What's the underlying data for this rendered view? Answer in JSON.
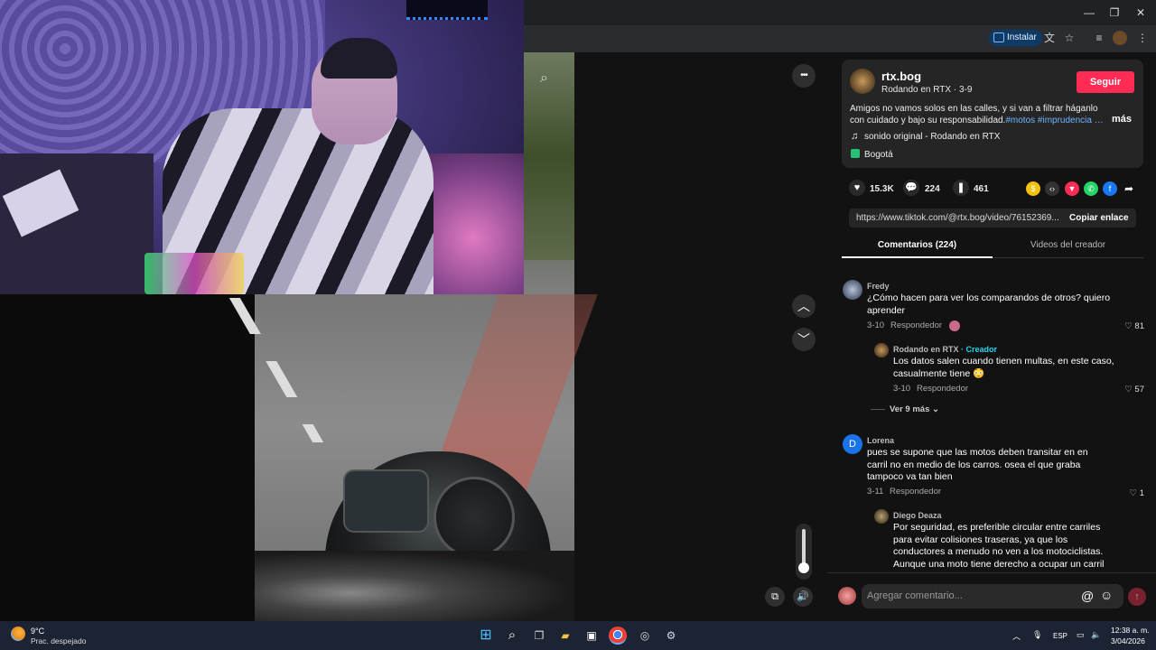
{
  "browser": {
    "install_label": "Instalar",
    "window_controls": [
      "—",
      "❐",
      "✕"
    ]
  },
  "video_controls": {
    "more_label": "•••",
    "volume_level": 0.75
  },
  "post": {
    "username": "rtx.bog",
    "nickname": "Rodando en RTX · 3-9",
    "follow_label": "Seguir",
    "description": "Amigos no vamos solos en las calles, y si van a filtrar háganlo con cuidado y bajo su responsabilidad.",
    "hashtags": "#motos #imprudencia …",
    "more_label": "más",
    "music": "sonido original - Rodando en RTX",
    "location": "Bogotá",
    "likes": "15.3K",
    "comments_count": "224",
    "saves": "461",
    "link": "https://www.tiktok.com/@rtx.bog/video/76152369...",
    "copy_label": "Copiar enlace"
  },
  "tabs": {
    "comments": "Comentarios (224)",
    "creator_videos": "Videos del creador"
  },
  "comments": [
    {
      "name": "Fredy",
      "text": "¿Cómo hacen para ver los comparandos de otros? quiero aprender",
      "date": "3-10",
      "reply_label": "Respondedor",
      "likes": "81",
      "reply": {
        "name": "Rodando en RTX",
        "creator_tag": "· Creador",
        "text": "Los datos salen cuando tienen multas, en este caso, casualmente tiene 😳",
        "date": "3-10",
        "reply_label": "Respondedor",
        "likes": "57"
      },
      "view_more": "Ver 9 más"
    },
    {
      "name": "Lorena",
      "avatar_letter": "D",
      "text": "pues se supone que las motos deben transitar en en carril no en medio de los carros. osea el que graba tampoco va tan bien",
      "date": "3-11",
      "reply_label": "Respondedor",
      "likes": "1",
      "reply": {
        "name": "Diego Deaza",
        "text": "Por seguridad, es preferible circular entre carriles para evitar colisiones traseras, ya que los conductores a menudo no ven a los motociclistas. Aunque una moto tiene derecho a ocupar un carril"
      }
    }
  ],
  "comment_input": {
    "placeholder": "Agregar comentario..."
  },
  "taskbar": {
    "temp": "9°C",
    "weather": "Prac. despejado",
    "lang": "ESP",
    "time": "12:38 a. m.",
    "date": "3/04/2026"
  },
  "colors": {
    "accent": "#fe2c55",
    "creator": "#20d5ec",
    "hashtag": "#6fb5ff"
  }
}
